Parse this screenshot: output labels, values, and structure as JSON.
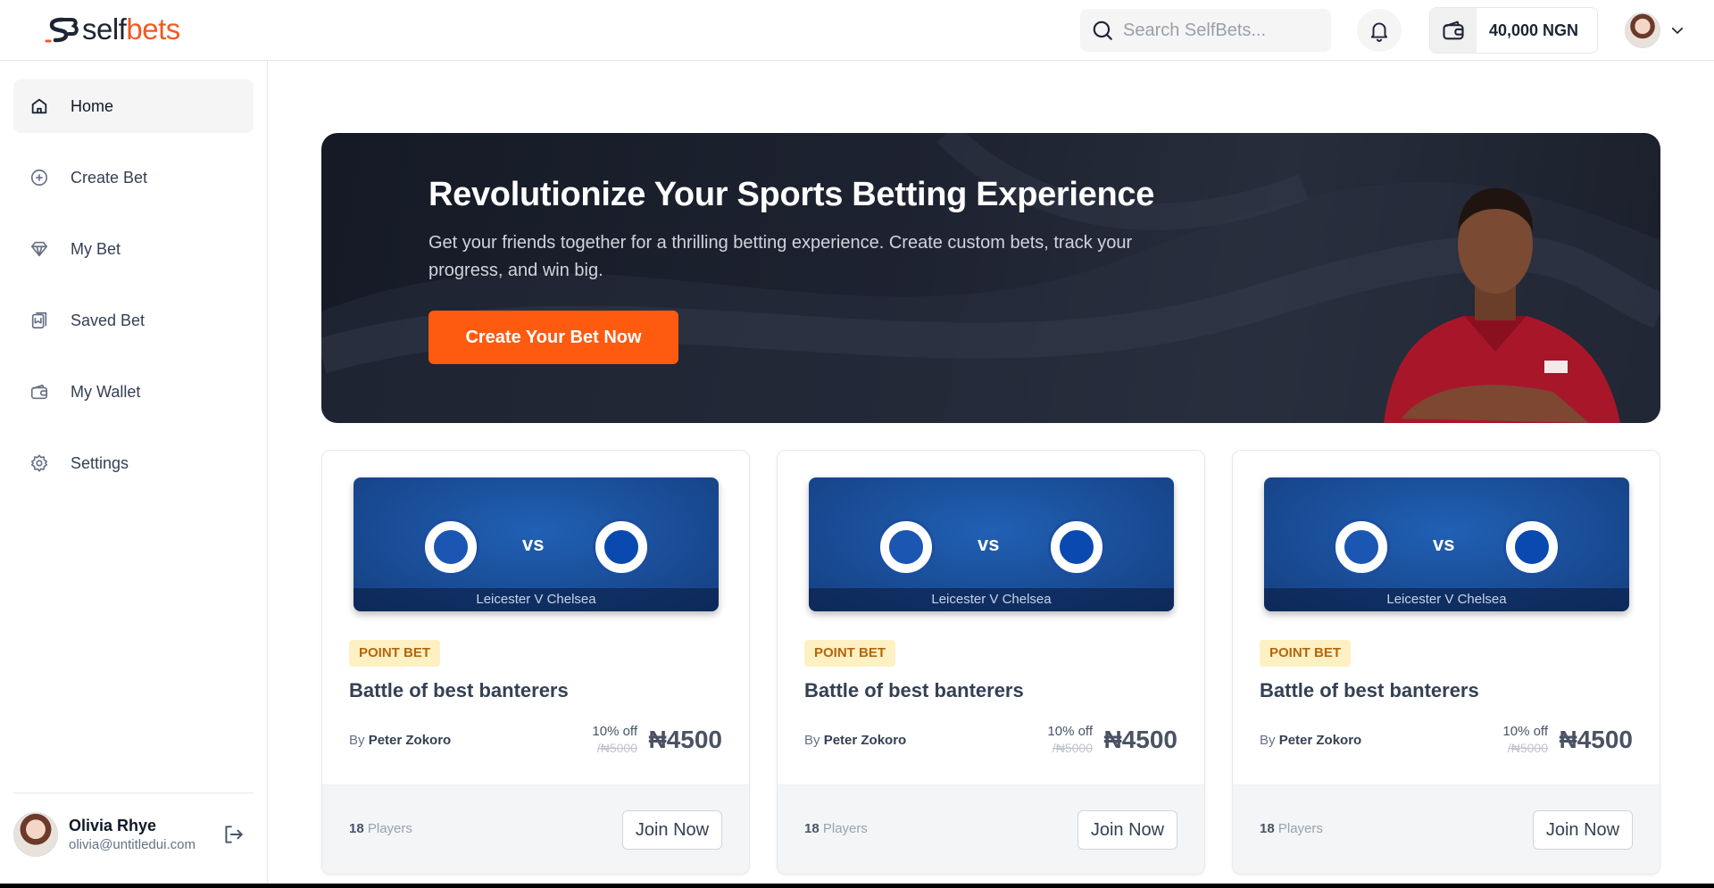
{
  "app": {
    "logo_prefix": "self",
    "logo_suffix": "bets"
  },
  "topbar": {
    "search_placeholder": "Search SelfBets...",
    "wallet_amount": "40,000 NGN"
  },
  "sidebar": {
    "items": [
      {
        "label": "Home",
        "icon": "home-icon",
        "active": true
      },
      {
        "label": "Create Bet",
        "icon": "plus-circle-icon"
      },
      {
        "label": "My Bet",
        "icon": "diamond-icon"
      },
      {
        "label": "Saved Bet",
        "icon": "bookmark-icon"
      },
      {
        "label": "My Wallet",
        "icon": "wallet-icon"
      },
      {
        "label": "Settings",
        "icon": "gear-icon"
      }
    ],
    "user": {
      "name": "Olivia Rhye",
      "email": "olivia@untitledui.com"
    }
  },
  "hero": {
    "title": "Revolutionize Your Sports Betting Experience",
    "subtitle": "Get your friends together for a thrilling betting experience. Create custom bets, track your progress, and win big.",
    "cta": "Create Your Bet Now"
  },
  "cards": [
    {
      "match": "Leicester V Chelsea",
      "vs": "vs",
      "tag": "POINT BET",
      "title": "Battle of best banterers",
      "by_prefix": "By",
      "author": "Peter Zokoro",
      "discount": "10% off",
      "old_price": "/₦5000",
      "price": "₦4500",
      "players_count": "18",
      "players_label": "Players",
      "join": "Join Now"
    },
    {
      "match": "Leicester V Chelsea",
      "vs": "vs",
      "tag": "POINT BET",
      "title": "Battle of best banterers",
      "by_prefix": "By",
      "author": "Peter Zokoro",
      "discount": "10% off",
      "old_price": "/₦5000",
      "price": "₦4500",
      "players_count": "18",
      "players_label": "Players",
      "join": "Join Now"
    },
    {
      "match": "Leicester V Chelsea",
      "vs": "vs",
      "tag": "POINT BET",
      "title": "Battle of best banterers",
      "by_prefix": "By",
      "author": "Peter Zokoro",
      "discount": "10% off",
      "old_price": "/₦5000",
      "price": "₦4500",
      "players_count": "18",
      "players_label": "Players",
      "join": "Join Now"
    }
  ],
  "colors": {
    "brand_orange": "#fe5a10",
    "hero_bg": "#1e2331",
    "tag_bg": "#fdf1c4",
    "tag_text": "#b3660b"
  }
}
